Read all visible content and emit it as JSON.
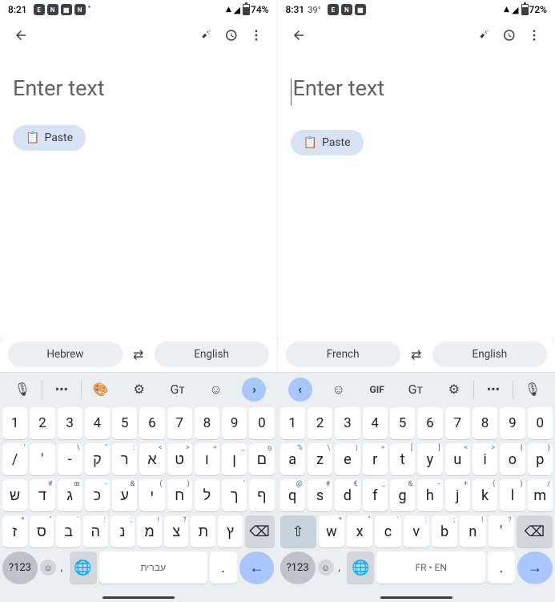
{
  "left": {
    "status": {
      "time": "8:21",
      "battery": "74%"
    },
    "placeholder": "Enter text",
    "show_cursor": false,
    "paste_label": "Paste",
    "lang_from": "Hebrew",
    "lang_to": "English",
    "toolbar_order": "ltr",
    "num_row": [
      "1",
      "2",
      "3",
      "4",
      "5",
      "6",
      "7",
      "8",
      "9",
      "0"
    ],
    "row2": [
      {
        "m": "/",
        "h": "'"
      },
      {
        "m": "'",
        "h": ""
      },
      {
        "m": "-",
        "h": "\\"
      },
      {
        "m": "ק",
        "h": "\""
      },
      {
        "m": "ר",
        "h": ":"
      },
      {
        "m": "א",
        "h": "<"
      },
      {
        "m": "ט",
        "h": ">"
      },
      {
        "m": "ו",
        "h": "="
      },
      {
        "m": "ן",
        "h": "_"
      },
      {
        "m": "ם",
        "h": "פ"
      }
    ],
    "row3": [
      {
        "m": "ש",
        "h": ""
      },
      {
        "m": "ד",
        "h": "#"
      },
      {
        "m": "ג",
        "h": "₪"
      },
      {
        "m": "כ",
        "h": "-"
      },
      {
        "m": "ע",
        "h": "&"
      },
      {
        "m": "י",
        "h": "("
      },
      {
        "m": "ח",
        "h": ")"
      },
      {
        "m": "ל",
        "h": ""
      },
      {
        "m": "ך",
        "h": "'"
      },
      {
        "m": "ף",
        "h": ""
      }
    ],
    "row4": [
      {
        "m": "ז",
        "h": "*"
      },
      {
        "m": "ס",
        "h": "\""
      },
      {
        "m": "ב",
        "h": "'"
      },
      {
        "m": "ה",
        "h": ":"
      },
      {
        "m": "נ",
        "h": ";"
      },
      {
        "m": "מ",
        "h": "!"
      },
      {
        "m": "צ",
        "h": "?"
      },
      {
        "m": "ת",
        "h": ""
      },
      {
        "m": "ץ",
        "h": ""
      }
    ],
    "sym_label": "?123",
    "space_label": "עברית",
    "period": ".",
    "enter_dir": "←"
  },
  "right": {
    "status": {
      "time": "8:31",
      "temp": "39°",
      "battery": "72%"
    },
    "placeholder": "Enter text",
    "show_cursor": true,
    "paste_label": "Paste",
    "lang_from": "French",
    "lang_to": "English",
    "toolbar_order": "rtl",
    "num_row": [
      "1",
      "2",
      "3",
      "4",
      "5",
      "6",
      "7",
      "8",
      "9",
      "0"
    ],
    "row2": [
      {
        "m": "a",
        "h": "%"
      },
      {
        "m": "z",
        "h": "\\"
      },
      {
        "m": "e",
        "h": "|"
      },
      {
        "m": "r",
        "h": "="
      },
      {
        "m": "t",
        "h": "["
      },
      {
        "m": "y",
        "h": "]"
      },
      {
        "m": "u",
        "h": "<"
      },
      {
        "m": "i",
        "h": ">"
      },
      {
        "m": "o",
        "h": "{"
      },
      {
        "m": "p",
        "h": "}"
      }
    ],
    "row3": [
      {
        "m": "q",
        "h": "@"
      },
      {
        "m": "s",
        "h": "#"
      },
      {
        "m": "d",
        "h": "€"
      },
      {
        "m": "f",
        "h": "_"
      },
      {
        "m": "g",
        "h": "&"
      },
      {
        "m": "h",
        "h": "-"
      },
      {
        "m": "j",
        "h": "+"
      },
      {
        "m": "k",
        "h": "("
      },
      {
        "m": "l",
        "h": ")"
      },
      {
        "m": "m",
        "h": "/"
      }
    ],
    "row4": [
      {
        "m": "w",
        "h": "*"
      },
      {
        "m": "x",
        "h": "\""
      },
      {
        "m": "c",
        "h": "'"
      },
      {
        "m": "v",
        "h": ":"
      },
      {
        "m": "b",
        "h": ";"
      },
      {
        "m": "n",
        "h": "!"
      },
      {
        "m": "'",
        "h": "?"
      }
    ],
    "sym_label": "?123",
    "space_label": "FR • EN",
    "period": ".",
    "enter_dir": "→"
  },
  "icons": {
    "palette": "🎨",
    "gear": "⚙",
    "translate": "ᴳ",
    "sticker": "☺",
    "mic": "🎤",
    "dots": "•••",
    "gif": "GIF",
    "clipboard": "📋"
  }
}
